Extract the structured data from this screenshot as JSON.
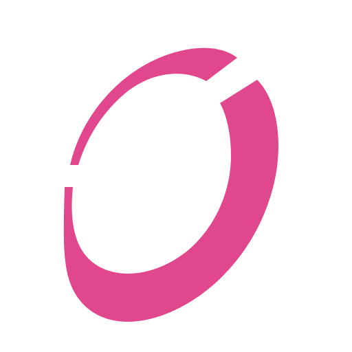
{
  "logo": {
    "name": "pink-ring-logo",
    "primary_color": "#E0478C",
    "background_color": "#FFFFFF"
  }
}
